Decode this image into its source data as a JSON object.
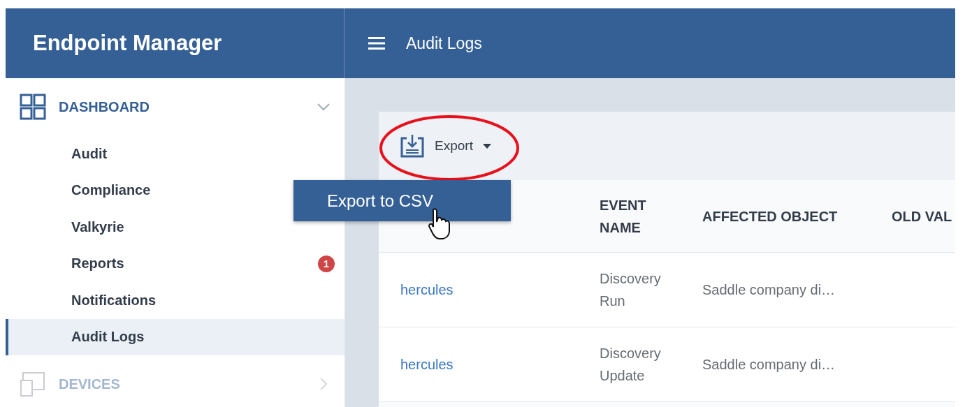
{
  "app_title": "Endpoint Manager",
  "page_title": "Audit Logs",
  "sidebar": [
    {
      "label": "DASHBOARD",
      "kind": "dashboard",
      "expanded": true,
      "disabled": false,
      "children": [
        {
          "label": "Audit",
          "selected": false
        },
        {
          "label": "Compliance",
          "selected": false
        },
        {
          "label": "Valkyrie",
          "selected": false
        },
        {
          "label": "Reports",
          "selected": false,
          "badge": "1"
        },
        {
          "label": "Notifications",
          "selected": false
        },
        {
          "label": "Audit Logs",
          "selected": true
        }
      ]
    },
    {
      "label": "DEVICES",
      "kind": "devices",
      "expanded": false,
      "disabled": true
    }
  ],
  "toolbar": {
    "export_label": "Export",
    "menu": [
      "Export to CSV"
    ]
  },
  "table": {
    "columns": [
      "",
      "EVENT\nNAME",
      "AFFECTED OBJECT",
      "OLD VAL"
    ],
    "rows": [
      {
        "cells": [
          "hercules",
          "Discovery\nRun",
          "Saddle company di…"
        ]
      },
      {
        "cells": [
          "hercules",
          "Discovery\nUpdate",
          "Saddle company di…"
        ]
      }
    ]
  }
}
